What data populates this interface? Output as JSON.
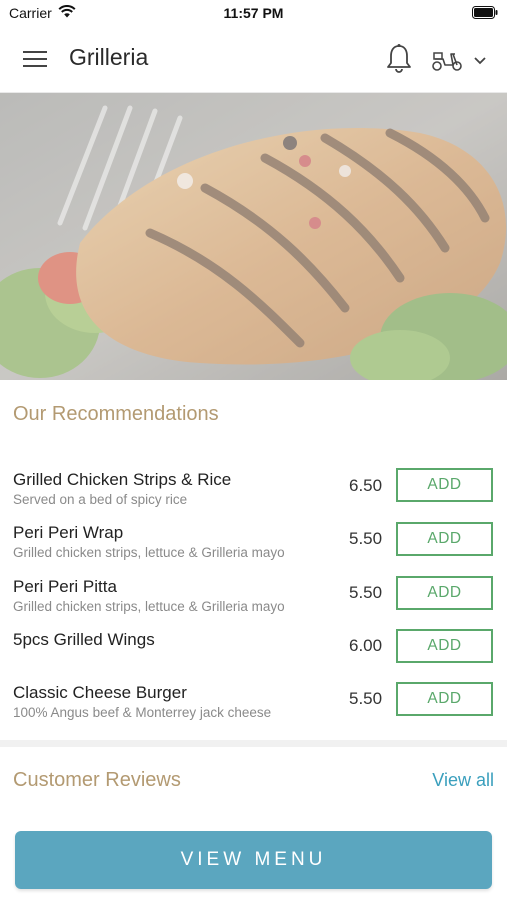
{
  "status_bar": {
    "carrier": "Carrier",
    "time": "11:57 PM"
  },
  "header": {
    "title": "Grilleria",
    "icons": [
      "menu-icon",
      "bell-icon",
      "scooter-icon",
      "chevron-down-icon"
    ]
  },
  "recommendations": {
    "title": "Our Recommendations",
    "add_label": "ADD",
    "items": [
      {
        "name": "Grilled Chicken Strips & Rice",
        "description": "Served on a bed of spicy rice",
        "price": "6.50"
      },
      {
        "name": "Peri Peri Wrap",
        "description": "Grilled chicken strips, lettuce & Grilleria mayo",
        "price": "5.50"
      },
      {
        "name": "Peri Peri Pitta",
        "description": "Grilled chicken strips, lettuce & Grilleria mayo",
        "price": "5.50"
      },
      {
        "name": "5pcs Grilled Wings",
        "description": "",
        "price": "6.00"
      },
      {
        "name": "Classic Cheese Burger",
        "description": "100% Angus beef & Monterrey jack cheese",
        "price": "5.50"
      }
    ]
  },
  "reviews": {
    "title": "Customer Reviews",
    "view_all": "View all"
  },
  "footer": {
    "view_menu": "VIEW MENU"
  },
  "colors": {
    "accent_gold": "#b39a72",
    "add_green": "#5aa86b",
    "link_blue": "#3a9fbd",
    "button_blue": "#5ba6bf"
  }
}
